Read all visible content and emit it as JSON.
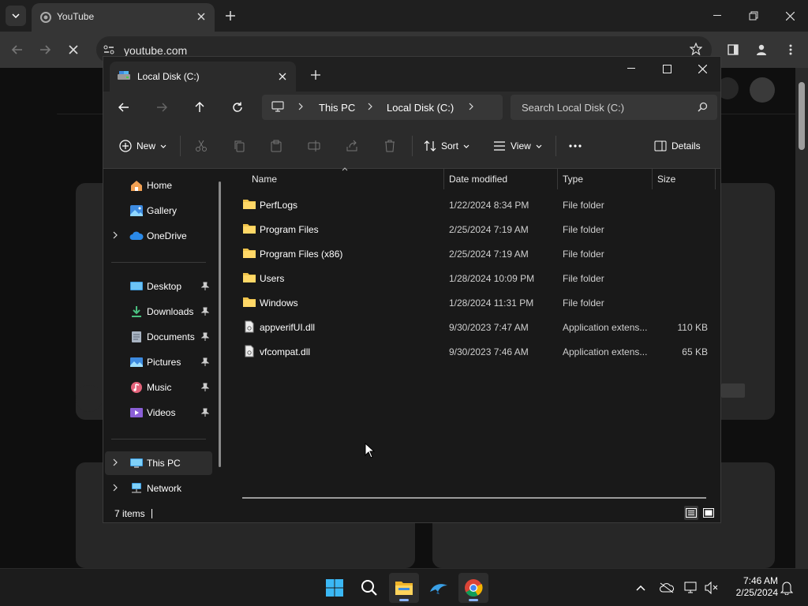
{
  "browser": {
    "tab_title": "YouTube",
    "url": "youtube.com"
  },
  "explorer": {
    "tab_title": "Local Disk (C:)",
    "breadcrumbs": [
      "This PC",
      "Local Disk (C:)"
    ],
    "search_placeholder": "Search Local Disk (C:)",
    "commands": {
      "new": "New",
      "sort": "Sort",
      "view": "View",
      "details": "Details"
    },
    "nav": {
      "home": "Home",
      "gallery": "Gallery",
      "onedrive": "OneDrive",
      "desktop": "Desktop",
      "downloads": "Downloads",
      "documents": "Documents",
      "pictures": "Pictures",
      "music": "Music",
      "videos": "Videos",
      "this_pc": "This PC",
      "network": "Network"
    },
    "columns": [
      "Name",
      "Date modified",
      "Type",
      "Size"
    ],
    "files": [
      {
        "name": "PerfLogs",
        "date": "1/22/2024 8:34 PM",
        "type": "File folder",
        "size": "",
        "kind": "folder"
      },
      {
        "name": "Program Files",
        "date": "2/25/2024 7:19 AM",
        "type": "File folder",
        "size": "",
        "kind": "folder"
      },
      {
        "name": "Program Files (x86)",
        "date": "2/25/2024 7:19 AM",
        "type": "File folder",
        "size": "",
        "kind": "folder"
      },
      {
        "name": "Users",
        "date": "1/28/2024 10:09 PM",
        "type": "File folder",
        "size": "",
        "kind": "folder"
      },
      {
        "name": "Windows",
        "date": "1/28/2024 11:31 PM",
        "type": "File folder",
        "size": "",
        "kind": "folder"
      },
      {
        "name": "appverifUI.dll",
        "date": "9/30/2023 7:47 AM",
        "type": "Application extens...",
        "size": "110 KB",
        "kind": "file"
      },
      {
        "name": "vfcompat.dll",
        "date": "9/30/2023 7:46 AM",
        "type": "Application extens...",
        "size": "65 KB",
        "kind": "file"
      }
    ],
    "status_count": "7 items"
  },
  "taskbar": {
    "time": "7:46 AM",
    "date": "2/25/2024"
  },
  "colors": {
    "folder": "#f0c44c",
    "accent": "#8ab4f8"
  }
}
